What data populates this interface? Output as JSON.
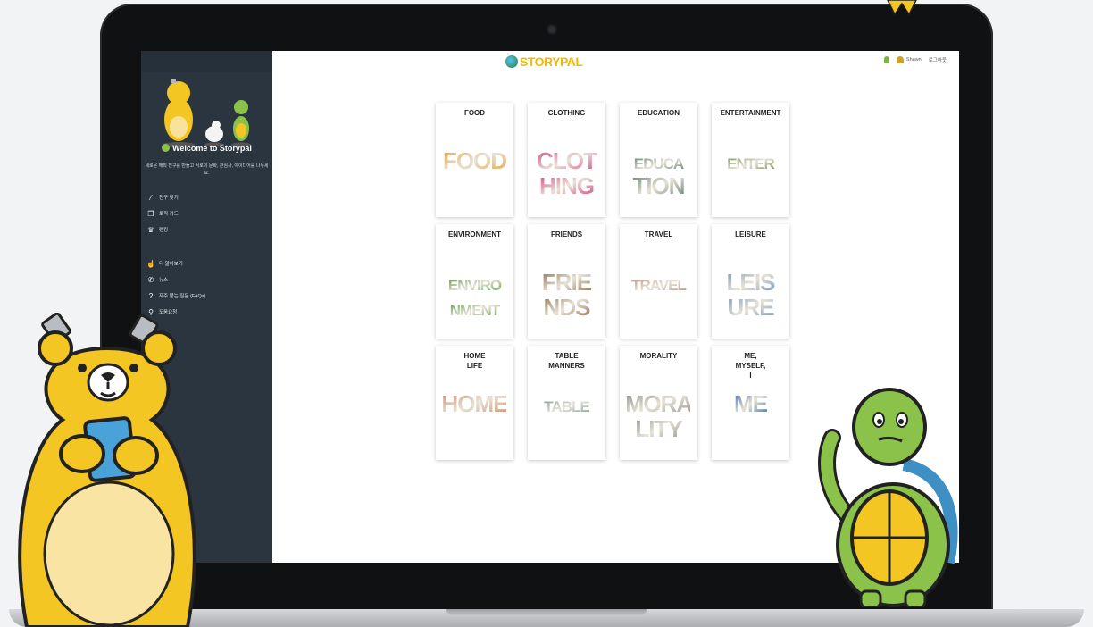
{
  "app": {
    "logo_text": "STORYPAL",
    "user_name": "Shawn",
    "logout_label": "로그아웃"
  },
  "sidebar": {
    "welcome_title": "Welcome to Storypal",
    "welcome_subtitle": "세로운 해외 친구를 만들고 서로의 문화, 관심사, 아이디어를 나누세요.",
    "menu": [
      {
        "label": "친구 찾기",
        "icon": "magic-wand-icon"
      },
      {
        "label": "토픽 카드",
        "icon": "cards-icon"
      },
      {
        "label": "랭킹",
        "icon": "trophy-icon"
      },
      {
        "label": "더 알아보기",
        "icon": "thumbs-up-icon"
      },
      {
        "label": "뉴스",
        "icon": "megaphone-icon"
      },
      {
        "label": "자주 묻는 질문 (FAQs)",
        "icon": "question-icon"
      },
      {
        "label": "도움요청",
        "icon": "help-icon"
      }
    ]
  },
  "topics": [
    {
      "title": "FOOD",
      "art_label": "FOOD",
      "color": "#e8a23a"
    },
    {
      "title": "CLOTHING",
      "art_label": "CLOTHING",
      "color": "#d43a7a"
    },
    {
      "title": "EDUCATION",
      "art_label": "EDUCATION",
      "color": "#5f7a6e"
    },
    {
      "title": "ENTERTAINMENT",
      "art_label": "ENTER",
      "color": "#6b8c4a"
    },
    {
      "title": "ENVIRONMENT",
      "art_label": "ENVIRONMENT",
      "color": "#4f9a3a"
    },
    {
      "title": "FRIENDS",
      "art_label": "FRIENDS",
      "color": "#8a6a4a"
    },
    {
      "title": "TRAVEL",
      "art_label": "TRAVEL",
      "color": "#b98a7a"
    },
    {
      "title": "LEISURE",
      "art_label": "LEISURE",
      "color": "#6e8fb0"
    },
    {
      "title": "HOME\nLIFE",
      "art_label": "HOME",
      "color": "#c98a6a"
    },
    {
      "title": "TABLE\nMANNERS",
      "art_label": "TABLE",
      "color": "#7a9a8a"
    },
    {
      "title": "MORALITY",
      "art_label": "MORALITY",
      "color": "#8a8a8a"
    },
    {
      "title": "ME,\nMYSELF,\nI",
      "art_label": "ME",
      "color": "#3a6aa0"
    }
  ],
  "theme": {
    "sidebar_bg": "#2a3540",
    "accent_yellow": "#f3b800",
    "accent_green": "#8bc34a"
  }
}
